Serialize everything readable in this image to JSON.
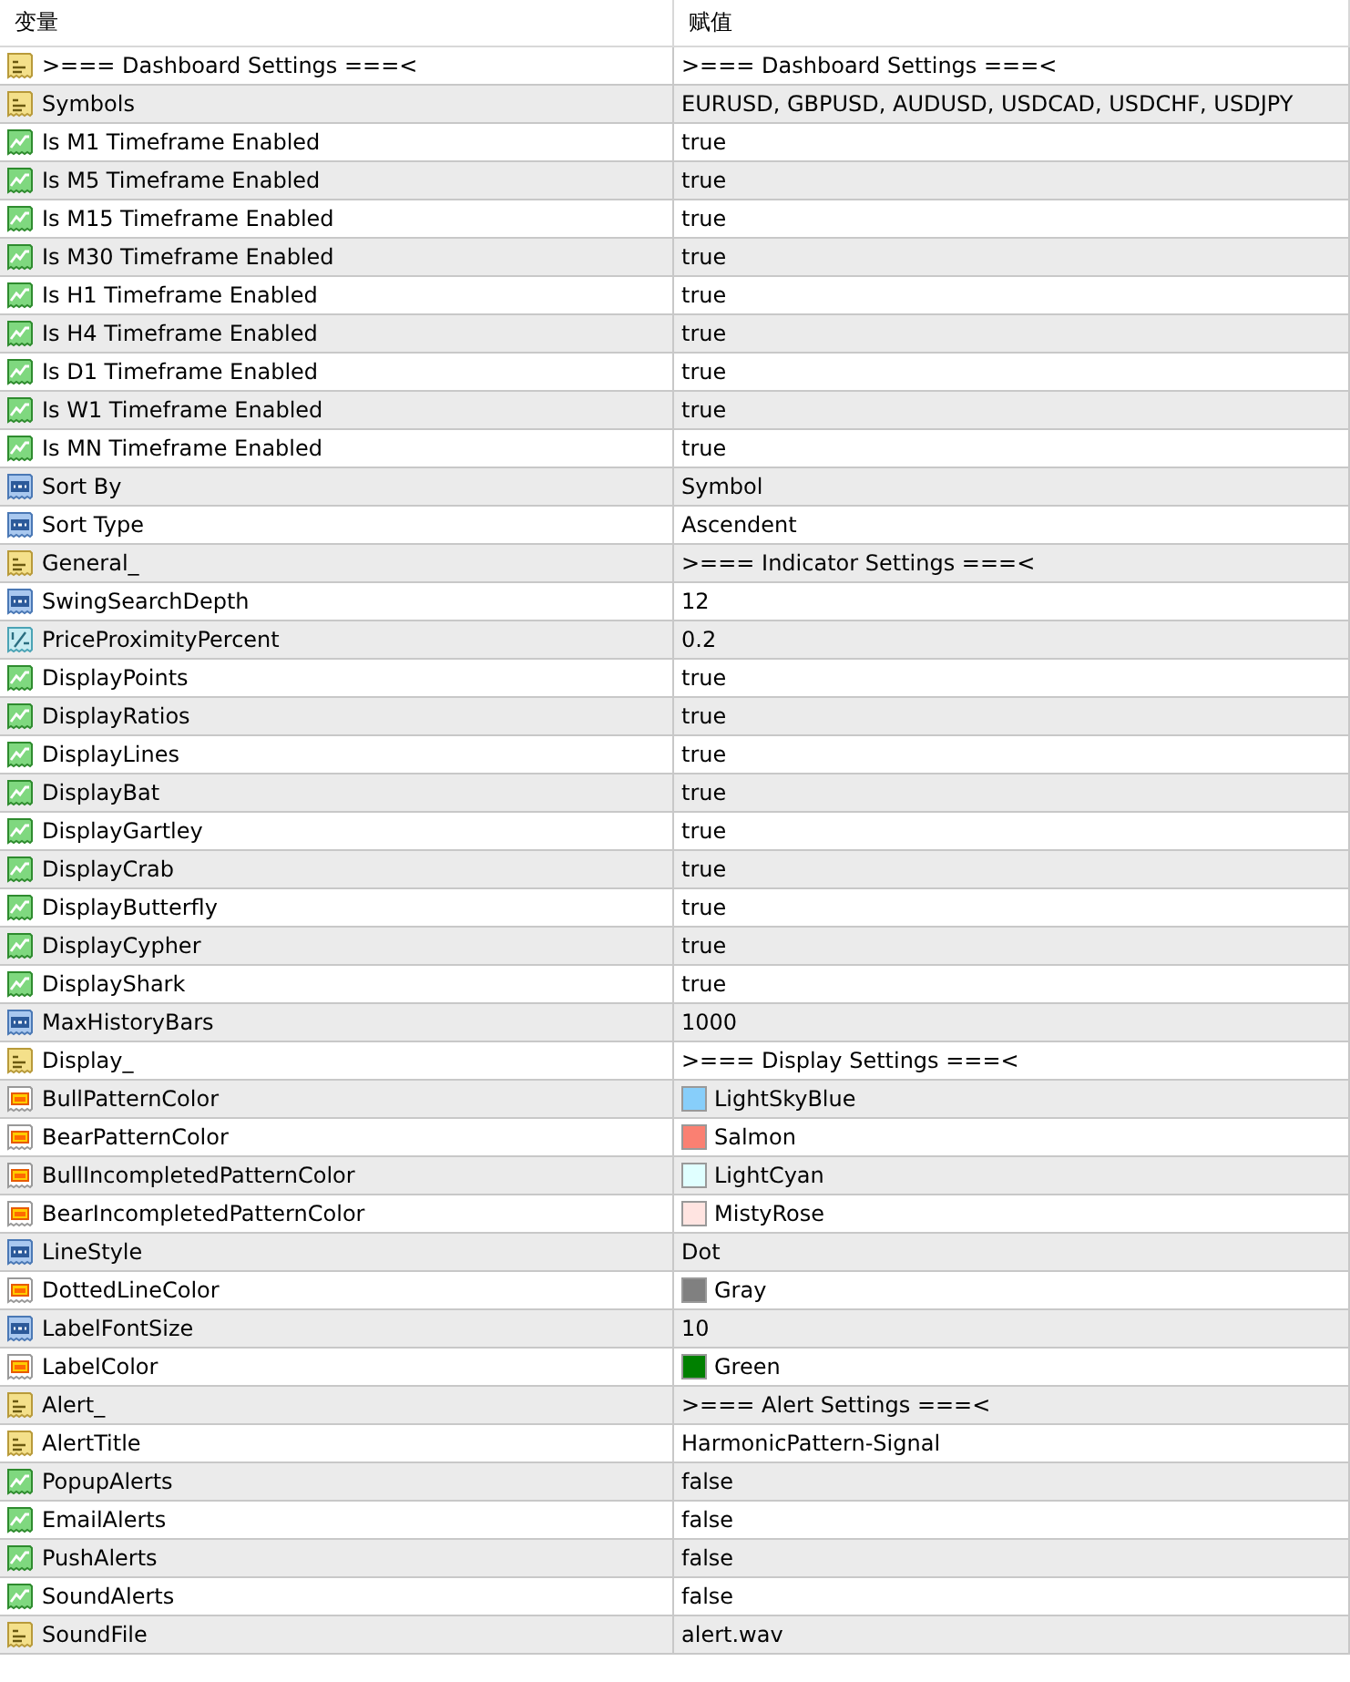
{
  "columns": [
    "变量",
    "赋值"
  ],
  "rows": [
    {
      "kind": "string",
      "name": ">=== Dashboard Settings ===<",
      "value": ">=== Dashboard Settings ===<"
    },
    {
      "kind": "string",
      "name": "Symbols",
      "value": "EURUSD, GBPUSD, AUDUSD, USDCAD, USDCHF, USDJPY"
    },
    {
      "kind": "bool",
      "name": "Is M1 Timeframe Enabled",
      "value": "true"
    },
    {
      "kind": "bool",
      "name": "Is M5 Timeframe Enabled",
      "value": "true"
    },
    {
      "kind": "bool",
      "name": "Is M15 Timeframe Enabled",
      "value": "true"
    },
    {
      "kind": "bool",
      "name": "Is M30 Timeframe Enabled",
      "value": "true"
    },
    {
      "kind": "bool",
      "name": "Is H1 Timeframe Enabled",
      "value": "true"
    },
    {
      "kind": "bool",
      "name": "Is H4 Timeframe Enabled",
      "value": "true"
    },
    {
      "kind": "bool",
      "name": "Is D1 Timeframe Enabled",
      "value": "true"
    },
    {
      "kind": "bool",
      "name": "Is W1 Timeframe Enabled",
      "value": "true"
    },
    {
      "kind": "bool",
      "name": "Is MN Timeframe Enabled",
      "value": "true"
    },
    {
      "kind": "int",
      "name": "Sort By",
      "value": "Symbol"
    },
    {
      "kind": "int",
      "name": "Sort Type",
      "value": "Ascendent"
    },
    {
      "kind": "string",
      "name": "General_",
      "value": ">=== Indicator Settings ===<"
    },
    {
      "kind": "int",
      "name": "SwingSearchDepth",
      "value": "12"
    },
    {
      "kind": "double",
      "name": "PriceProximityPercent",
      "value": "0.2"
    },
    {
      "kind": "bool",
      "name": "DisplayPoints",
      "value": "true"
    },
    {
      "kind": "bool",
      "name": "DisplayRatios",
      "value": "true"
    },
    {
      "kind": "bool",
      "name": "DisplayLines",
      "value": "true"
    },
    {
      "kind": "bool",
      "name": "DisplayBat",
      "value": "true"
    },
    {
      "kind": "bool",
      "name": "DisplayGartley",
      "value": "true"
    },
    {
      "kind": "bool",
      "name": "DisplayCrab",
      "value": "true"
    },
    {
      "kind": "bool",
      "name": "DisplayButterfly",
      "value": "true"
    },
    {
      "kind": "bool",
      "name": "DisplayCypher",
      "value": "true"
    },
    {
      "kind": "bool",
      "name": "DisplayShark",
      "value": "true"
    },
    {
      "kind": "int",
      "name": "MaxHistoryBars",
      "value": "1000"
    },
    {
      "kind": "string",
      "name": "Display_",
      "value": ">=== Display Settings ===<"
    },
    {
      "kind": "color",
      "name": "BullPatternColor",
      "value": "LightSkyBlue",
      "color": "#87cefa"
    },
    {
      "kind": "color",
      "name": "BearPatternColor",
      "value": "Salmon",
      "color": "#fa8072"
    },
    {
      "kind": "color",
      "name": "BullIncompletedPatternColor",
      "value": "LightCyan",
      "color": "#e0ffff"
    },
    {
      "kind": "color",
      "name": "BearIncompletedPatternColor",
      "value": "MistyRose",
      "color": "#ffe4e1"
    },
    {
      "kind": "int",
      "name": "LineStyle",
      "value": "Dot"
    },
    {
      "kind": "color",
      "name": "DottedLineColor",
      "value": "Gray",
      "color": "#808080"
    },
    {
      "kind": "int",
      "name": "LabelFontSize",
      "value": "10"
    },
    {
      "kind": "color",
      "name": "LabelColor",
      "value": "Green",
      "color": "#008000"
    },
    {
      "kind": "string",
      "name": "Alert_",
      "value": ">=== Alert Settings ===<"
    },
    {
      "kind": "string",
      "name": "AlertTitle",
      "value": "HarmonicPattern-Signal"
    },
    {
      "kind": "bool",
      "name": "PopupAlerts",
      "value": "false"
    },
    {
      "kind": "bool",
      "name": "EmailAlerts",
      "value": "false"
    },
    {
      "kind": "bool",
      "name": "PushAlerts",
      "value": "false"
    },
    {
      "kind": "bool",
      "name": "SoundAlerts",
      "value": "false"
    },
    {
      "kind": "string",
      "name": "SoundFile",
      "value": "alert.wav"
    }
  ]
}
